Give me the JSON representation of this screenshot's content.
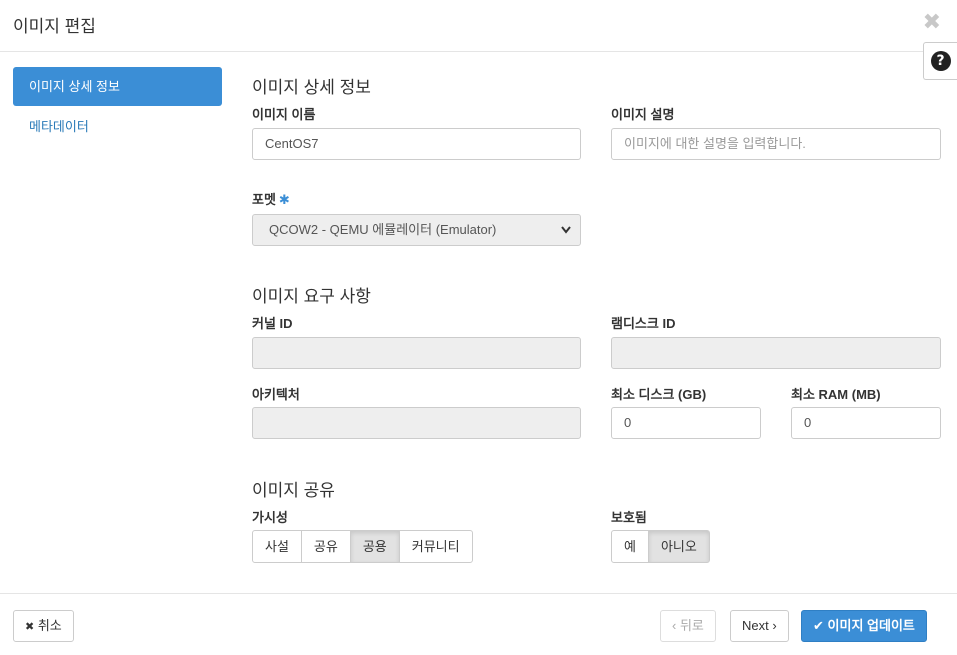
{
  "header": {
    "title": "이미지 편집",
    "close_glyph": "✖",
    "help_glyph": "?"
  },
  "sidebar": {
    "items": [
      {
        "label": "이미지 상세 정보"
      },
      {
        "label": "메타데이터"
      }
    ]
  },
  "details": {
    "section_title": "이미지 상세 정보",
    "name_label": "이미지 이름",
    "name_value": "CentOS7",
    "desc_label": "이미지 설명",
    "desc_placeholder": "이미지에 대한 설명을 입력합니다.",
    "format_label": "포멧",
    "required_mark": "✱",
    "format_value": "QCOW2 - QEMU 에뮬레이터 (Emulator)"
  },
  "requirements": {
    "section_title": "이미지 요구 사항",
    "kernel_label": "커널 ID",
    "kernel_value": "",
    "ramdisk_label": "램디스크 ID",
    "ramdisk_value": "",
    "arch_label": "아키텍처",
    "arch_value": "",
    "min_disk_label": "최소 디스크 (GB)",
    "min_disk_value": "0",
    "min_ram_label": "최소 RAM (MB)",
    "min_ram_value": "0"
  },
  "sharing": {
    "section_title": "이미지 공유",
    "visibility_label": "가시성",
    "visibility_options": [
      "사설",
      "공유",
      "공용",
      "커뮤니티"
    ],
    "visibility_selected": "공용",
    "protected_label": "보호됨",
    "protected_options": [
      "예",
      "아니오"
    ],
    "protected_selected": "아니오"
  },
  "footer": {
    "cancel_label": "취소",
    "cancel_icon": "✖",
    "back_label": "‹ 뒤로",
    "next_label": "Next ›",
    "update_icon": "✔",
    "update_label": "이미지 업데이트"
  }
}
